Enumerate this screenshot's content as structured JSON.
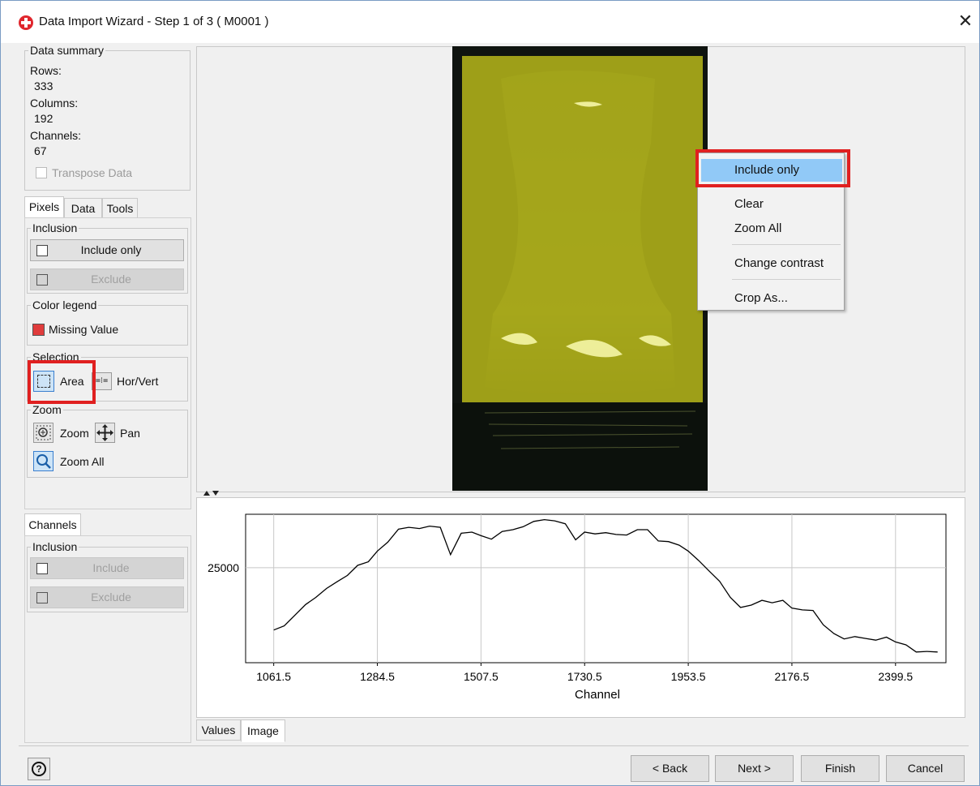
{
  "window": {
    "title": "Data Import Wizard - Step 1 of 3 ( M0001 )"
  },
  "summary": {
    "legend": "Data summary",
    "rows_label": "Rows:",
    "rows_value": "333",
    "columns_label": "Columns:",
    "columns_value": "192",
    "channels_label": "Channels:",
    "channels_value": "67",
    "transpose_label": "Transpose Data"
  },
  "tabs_top": [
    "Pixels",
    "Data",
    "Tools"
  ],
  "pixels": {
    "inclusion_legend": "Inclusion",
    "include_only": "Include only",
    "exclude": "Exclude",
    "color_legend": "Color legend",
    "missing_value": "Missing Value",
    "missing_color": "#e03c3c",
    "selection_legend": "Selection",
    "area": "Area",
    "horvert": "Hor/Vert",
    "zoom_legend": "Zoom",
    "zoom": "Zoom",
    "pan": "Pan",
    "zoom_all": "Zoom All"
  },
  "channels_tab": "Channels",
  "channels": {
    "inclusion_legend": "Inclusion",
    "include": "Include",
    "exclude": "Exclude"
  },
  "context_menu": {
    "items": [
      "Include only",
      "Clear",
      "Zoom All",
      "Change contrast",
      "Crop As..."
    ]
  },
  "chart_data": {
    "type": "line",
    "xlabel": "Channel",
    "ylabel": "",
    "xticks": [
      "1061.5",
      "1284.5",
      "1507.5",
      "1730.5",
      "1953.5",
      "2176.5",
      "2399.5"
    ],
    "yticks": [
      "25000"
    ],
    "grid": true,
    "xlim": [
      1001,
      2508
    ],
    "ylim": [
      9000,
      34000
    ],
    "x": [
      1061.5,
      1084,
      1107,
      1130,
      1152,
      1175,
      1197,
      1220,
      1242,
      1265,
      1284.5,
      1307,
      1330,
      1352,
      1375,
      1397,
      1420,
      1442,
      1465,
      1488,
      1507.5,
      1530,
      1553,
      1576,
      1598,
      1621,
      1644,
      1666,
      1689,
      1711,
      1730.5,
      1753,
      1776,
      1798,
      1821,
      1844,
      1866,
      1889,
      1911,
      1934,
      1953.5,
      1976,
      1999,
      2021,
      2044,
      2066,
      2089,
      2112,
      2134,
      2157,
      2176.5,
      2199,
      2222,
      2244,
      2267,
      2289,
      2312,
      2334,
      2357,
      2380,
      2399.5,
      2422,
      2444,
      2467,
      2490
    ],
    "y": [
      14500,
      15200,
      17000,
      18800,
      20000,
      21500,
      22600,
      23700,
      25400,
      26000,
      27800,
      29300,
      31500,
      31800,
      31600,
      32000,
      31800,
      27200,
      30800,
      31000,
      30400,
      29800,
      31100,
      31400,
      31900,
      32800,
      33100,
      32900,
      32400,
      29700,
      31000,
      30700,
      30900,
      30600,
      30500,
      31400,
      31400,
      29500,
      29400,
      28800,
      27800,
      26200,
      24400,
      22700,
      20000,
      18300,
      18700,
      19500,
      19100,
      19500,
      18200,
      17900,
      17800,
      15400,
      13900,
      13000,
      13400,
      13100,
      12800,
      13300,
      12500,
      12000,
      10800,
      10900,
      10800
    ]
  },
  "bottom_tabs": [
    "Values",
    "Image"
  ],
  "footer": {
    "back": "< Back",
    "next": "Next >",
    "finish": "Finish",
    "cancel": "Cancel"
  },
  "colors": {
    "selection_overlay": "#d6d61c",
    "highlight": "#91c9f7",
    "annotation": "#e02020"
  }
}
